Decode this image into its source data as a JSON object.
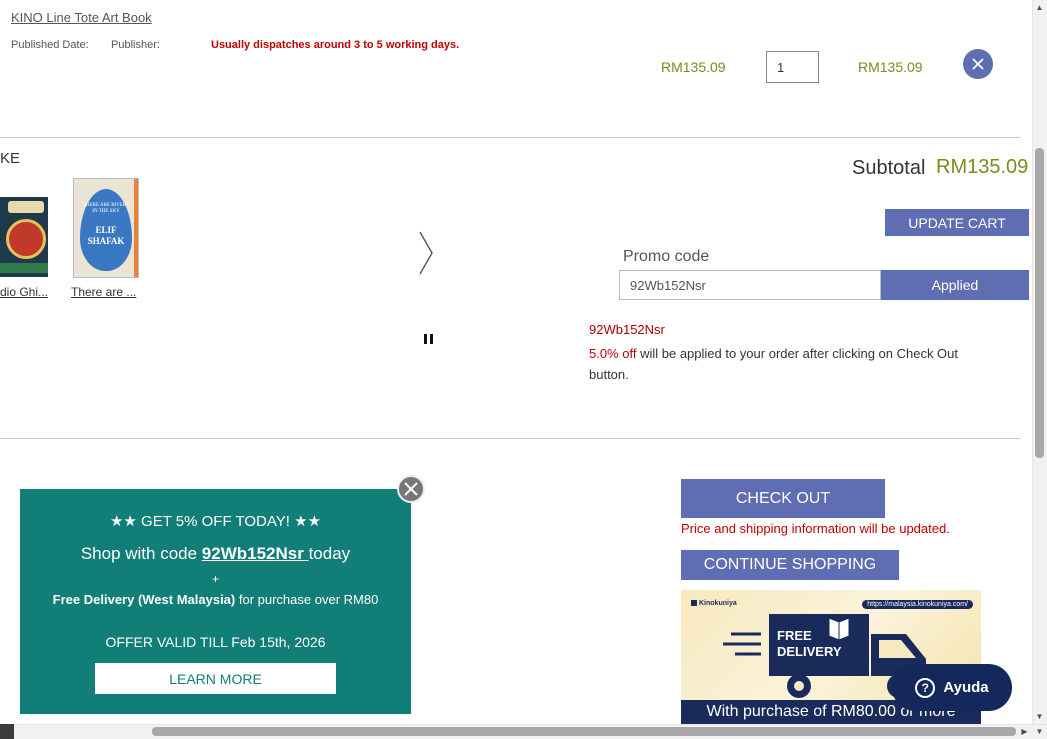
{
  "cart_item": {
    "title": "KINO Line Tote Art Book",
    "published_date_label": "Published Date:",
    "publisher_label": "Publisher:",
    "dispatch_note": "Usually dispatches around 3 to 5 working days.",
    "unit_price": "RM135.09",
    "quantity": "1",
    "line_total": "RM135.09"
  },
  "recommendations": {
    "heading": "KE",
    "items": [
      {
        "label": "dio Ghi..."
      },
      {
        "label": "There are ..."
      }
    ],
    "cover_2_text": {
      "top": "THERE ARE RIVERS IN THE SKY",
      "author_1": "ELIF",
      "author_2": "SHAFAK"
    }
  },
  "summary": {
    "subtotal_label": "Subtotal",
    "subtotal_value": "RM135.09",
    "update_cart": "UPDATE CART",
    "promo_label": "Promo code",
    "promo_value": "92Wb152Nsr",
    "applied_label": "Applied",
    "promo_code_msg": "92Wb152Nsr",
    "promo_percent": "5.0% off",
    "promo_desc_rest": " will be applied to your order after clicking on Check Out button."
  },
  "checkout": {
    "checkout_label": "CHECK OUT",
    "checkout_note": "Price and shipping information will be updated.",
    "continue_label": "CONTINUE SHOPPING"
  },
  "banner": {
    "logo_text": "Kinokuniya",
    "url_text": "https://malaysia.kinokuniya.com/",
    "truck_text_1": "FREE",
    "truck_text_2": "DELIVERY",
    "strip_text": "With purchase of RM80.00 or more"
  },
  "popup": {
    "line1": "★★  GET 5% OFF TODAY!  ★★",
    "shop_prefix": "Shop with code ",
    "code": "92Wb152Nsr ",
    "shop_suffix": "today",
    "plus": "+",
    "delivery_bold": "Free Delivery (West Malaysia)",
    "delivery_rest": " for purchase over RM80",
    "validity": "OFFER VALID TILL Feb 15th, 2026",
    "learn_more": "LEARN MORE"
  },
  "help": {
    "label": "Ayuda",
    "icon_glyph": "?"
  },
  "colors": {
    "accent_blue": "#5f6db2",
    "price_olive": "#7a8c1c",
    "alert_red": "#c00000",
    "popup_teal": "#127e78",
    "help_navy": "#14285c"
  }
}
